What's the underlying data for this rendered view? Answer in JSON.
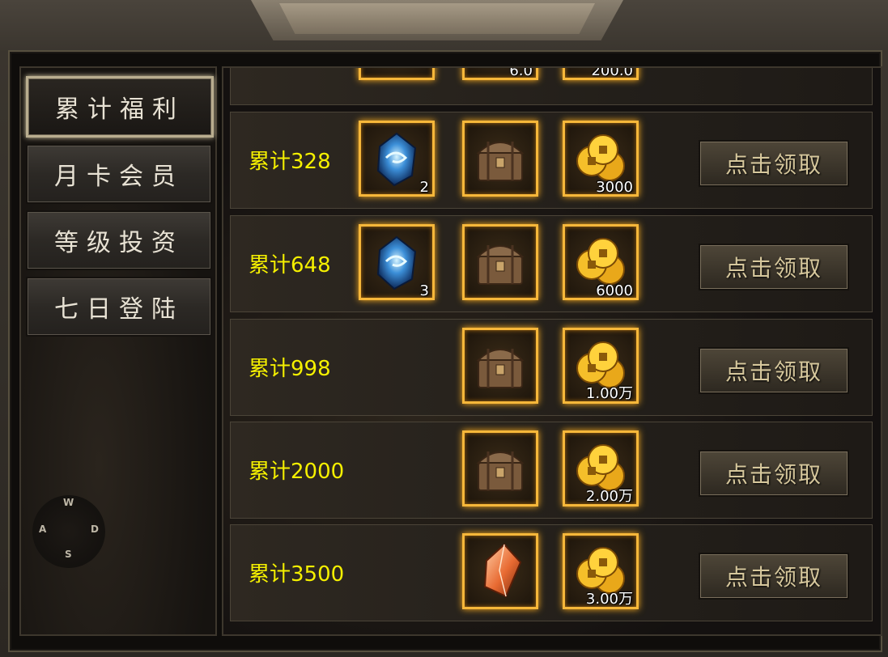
{
  "nav": {
    "items": [
      {
        "label": "累计福利",
        "active": true
      },
      {
        "label": "月卡会员",
        "active": false
      },
      {
        "label": "等级投资",
        "active": false
      },
      {
        "label": "七日登陆",
        "active": false
      }
    ]
  },
  "compass": {
    "w": "W",
    "a": "A",
    "d": "D",
    "s": "S"
  },
  "rewards": {
    "claim_label": "点击领取",
    "partial_row_counts": [
      "",
      "6.0",
      "200.0"
    ],
    "rows": [
      {
        "label": "累计328",
        "items": [
          {
            "icon": "blue-gem-icon",
            "count": "2"
          },
          {
            "icon": "treasure-chest-icon",
            "count": ""
          },
          {
            "icon": "gold-coins-icon",
            "count": "3000"
          }
        ]
      },
      {
        "label": "累计648",
        "items": [
          {
            "icon": "blue-gem-icon",
            "count": "3"
          },
          {
            "icon": "treasure-chest-icon",
            "count": ""
          },
          {
            "icon": "gold-coins-icon",
            "count": "6000"
          }
        ]
      },
      {
        "label": "累计998",
        "items": [
          {
            "icon": "treasure-chest-icon",
            "count": ""
          },
          {
            "icon": "gold-coins-icon",
            "count": "1.00万"
          }
        ]
      },
      {
        "label": "累计2000",
        "items": [
          {
            "icon": "treasure-chest-icon",
            "count": ""
          },
          {
            "icon": "gold-coins-icon",
            "count": "2.00万"
          }
        ]
      },
      {
        "label": "累计3500",
        "items": [
          {
            "icon": "orange-crystal-icon",
            "count": ""
          },
          {
            "icon": "gold-coins-icon",
            "count": "3.00万"
          }
        ]
      }
    ]
  },
  "colors": {
    "label_yellow": "#f5f000",
    "item_border": "#f6b73a",
    "claim_text": "#d6c79c"
  }
}
